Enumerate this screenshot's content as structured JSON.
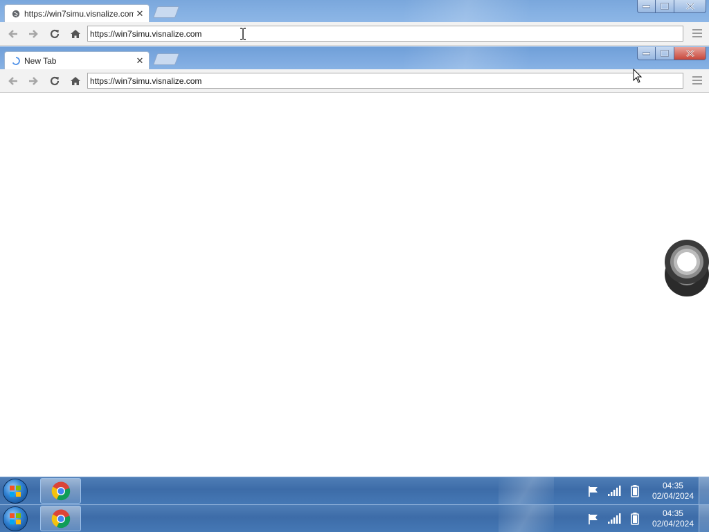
{
  "window_back": {
    "tab": {
      "title": "https://win7simu.visnalize.com",
      "icon": "globe-icon"
    },
    "toolbar": {
      "address": "https://win7simu.visnalize.com"
    }
  },
  "window_front": {
    "tab": {
      "title": "New Tab",
      "icon": "loading-spinner-icon"
    },
    "toolbar": {
      "address": "https://win7simu.visnalize.com"
    }
  },
  "taskbar": {
    "start_icon": "windows-orb-icon",
    "pinned": [
      "chrome-icon"
    ],
    "tray_icons": [
      "action-center-flag-icon",
      "network-signal-icon",
      "battery-icon"
    ],
    "clock": {
      "time": "04:35",
      "date": "02/04/2024"
    }
  },
  "colors": {
    "titlebar": "#7aa7dc",
    "taskbar": "#4578b5",
    "close_button": "#c7473a",
    "toolbar": "#f2f2f2"
  }
}
